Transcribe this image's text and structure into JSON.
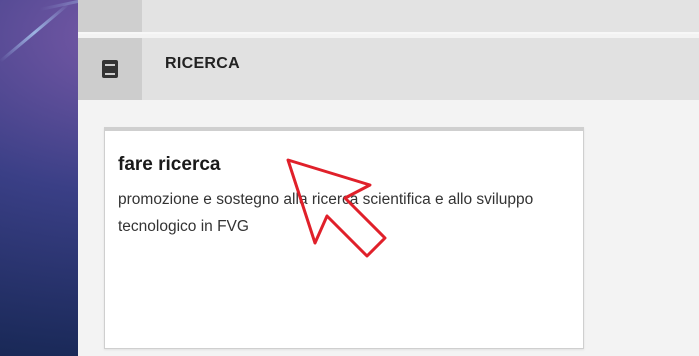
{
  "header": {
    "icon": "book-icon",
    "title": "RICERCA"
  },
  "card": {
    "title": "fare ricerca",
    "description": "promozione e sostegno alla ricerca scientifica e allo sviluppo tecnologico in FVG"
  },
  "colors": {
    "cursor": "#e0202a",
    "panel_bg": "#f3f3f3",
    "header_bg": "#e1e1e1"
  }
}
